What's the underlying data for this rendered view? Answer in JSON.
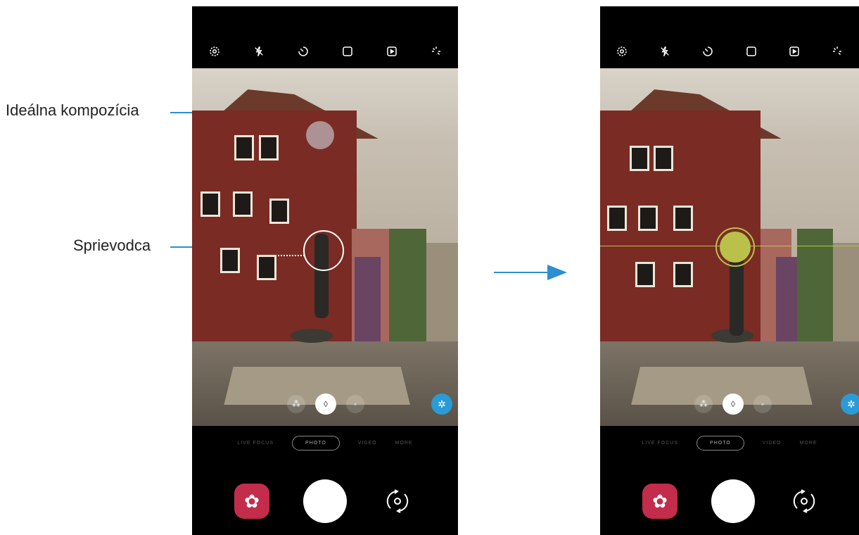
{
  "annotations": {
    "ideal_composition": "Ideálna kompozícia",
    "guide": "Sprievodca"
  },
  "camera_top_icons": [
    "gear-icon",
    "flash-off-icon",
    "timer-icon",
    "aspect-ratio-icon",
    "motion-photo-icon",
    "beauty-filter-icon"
  ],
  "modes": {
    "items": [
      "LIVE FOCUS",
      "PHOTO",
      "VIDEO",
      "MORE"
    ],
    "selected": "PHOTO"
  },
  "colors": {
    "accent": "#2b8fd0",
    "effects_button": "#c32c4b",
    "ai_button": "#2a9bd6",
    "composition_dot": "#b9c14a"
  }
}
